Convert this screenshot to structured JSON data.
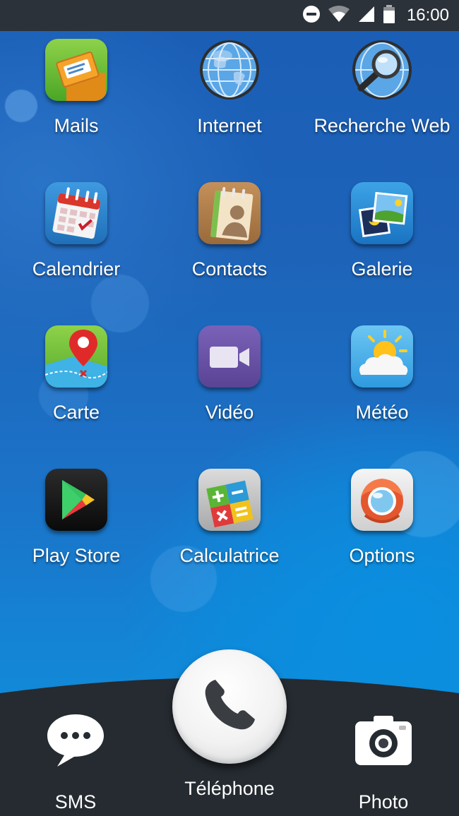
{
  "status_bar": {
    "time": "16:00",
    "icons": [
      "do-not-disturb-icon",
      "wifi-icon",
      "signal-icon",
      "battery-icon"
    ]
  },
  "apps": [
    {
      "id": "mails",
      "label": "Mails",
      "icon": "mail-icon"
    },
    {
      "id": "internet",
      "label": "Internet",
      "icon": "globe-icon"
    },
    {
      "id": "recherche-web",
      "label": "Recherche Web",
      "icon": "magnifier-icon"
    },
    {
      "id": "calendrier",
      "label": "Calendrier",
      "icon": "calendar-icon"
    },
    {
      "id": "contacts",
      "label": "Contacts",
      "icon": "contacts-book-icon"
    },
    {
      "id": "galerie",
      "label": "Galerie",
      "icon": "gallery-icon"
    },
    {
      "id": "carte",
      "label": "Carte",
      "icon": "map-pin-icon"
    },
    {
      "id": "video",
      "label": "Vidéo",
      "icon": "video-camera-icon"
    },
    {
      "id": "meteo",
      "label": "Météo",
      "icon": "weather-icon"
    },
    {
      "id": "play-store",
      "label": "Play Store",
      "icon": "play-store-icon"
    },
    {
      "id": "calculatrice",
      "label": "Calculatrice",
      "icon": "calculator-icon"
    },
    {
      "id": "options",
      "label": "Options",
      "icon": "options-icon"
    }
  ],
  "dock": {
    "sms": {
      "label": "SMS",
      "icon": "chat-bubble-icon"
    },
    "telephone": {
      "label": "Téléphone",
      "icon": "phone-handset-icon"
    },
    "photo": {
      "label": "Photo",
      "icon": "camera-icon"
    }
  },
  "colors": {
    "status_bar_bg": "#2c323a",
    "dock_bg": "#252b31",
    "wallpaper_blue": "#1a5db6"
  }
}
